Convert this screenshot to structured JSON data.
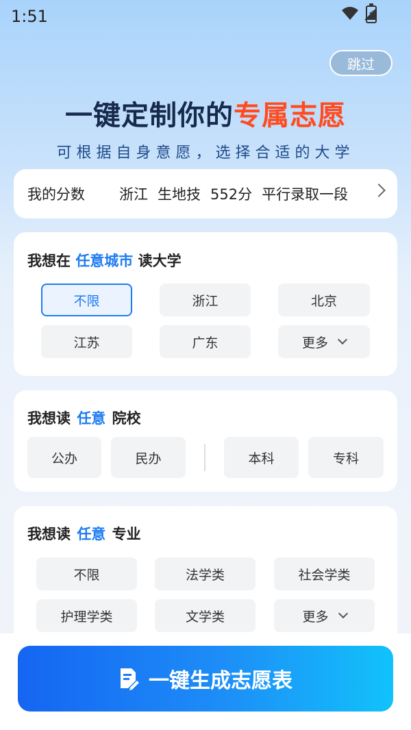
{
  "status_bar": {
    "time": "1:51"
  },
  "skip_label": "跳过",
  "hero": {
    "title_part1": "一键定制你的",
    "title_part2": "专属志愿",
    "subtitle": "可根据自身意愿，选择合适的大学"
  },
  "score": {
    "label": "我的分数",
    "province": "浙江",
    "subjects": "生地技",
    "points": "552分",
    "batch": "平行录取一段"
  },
  "city_section": {
    "prefix": "我想在",
    "highlight": "任意城市",
    "suffix": "读大学",
    "options": [
      "不限",
      "浙江",
      "北京",
      "江苏",
      "广东"
    ],
    "more_label": "更多",
    "selected": "不限"
  },
  "school_section": {
    "prefix": "我想读",
    "highlight": "任意",
    "suffix": "院校",
    "ownership_options": [
      "公办",
      "民办"
    ],
    "level_options": [
      "本科",
      "专科"
    ]
  },
  "major_section": {
    "prefix": "我想读",
    "highlight": "任意",
    "suffix": "专业",
    "options": [
      "不限",
      "法学类",
      "社会学类",
      "护理学类",
      "文学类"
    ],
    "more_label": "更多"
  },
  "generate_button": {
    "label": "一键生成志愿表"
  },
  "colors": {
    "accent": "#1d7bf2",
    "title_accent": "#ff4b1f",
    "button_start": "#1565f2",
    "button_end": "#12c2fb"
  }
}
